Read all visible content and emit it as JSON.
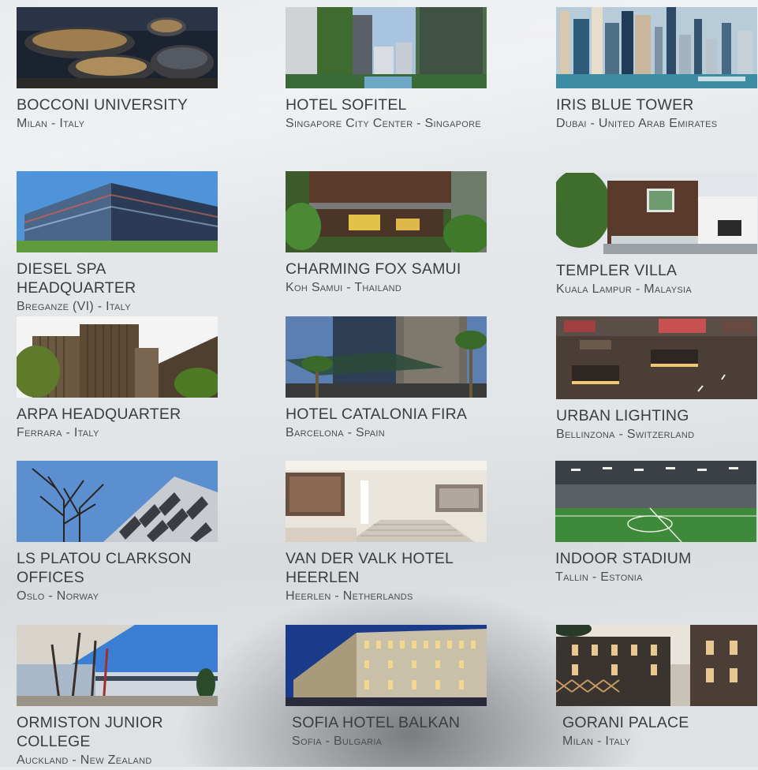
{
  "projects": [
    {
      "title": "BOCCONI UNIVERSITY",
      "location": "Milan - Italy",
      "image": "modern-campus-night-photo"
    },
    {
      "title": "HOTEL SOFITEL",
      "location": "Singapore City Center - Singapore",
      "image": "green-facade-hotel-photo"
    },
    {
      "title": "IRIS BLUE TOWER",
      "location": "Dubai - United Arab Emirates",
      "image": "marina-skyline-photo"
    },
    {
      "title": "DIESEL SPA HEADQUARTER",
      "location": "Breganze (VI) - Italy",
      "image": "glass-office-building-photo"
    },
    {
      "title": "CHARMING FOX SAMUI",
      "location": "Koh Samui - Thailand",
      "image": "tropical-resort-photo"
    },
    {
      "title": "TEMPLER VILLA",
      "location": "Kuala Lampur - Malaysia",
      "image": "modern-villa-photo"
    },
    {
      "title": "ARPA HEADQUARTER",
      "location": "Ferrara - Italy",
      "image": "wooden-slat-building-photo"
    },
    {
      "title": "HOTEL CATALONIA FIRA",
      "location": "Barcelona - Spain",
      "image": "hotel-tower-palms-photo"
    },
    {
      "title": "URBAN LIGHTING",
      "location": "Bellinzona - Switzerland",
      "image": "lit-plaza-night-photo"
    },
    {
      "title": "LS PLATOU CLARKSON OFFICES",
      "location": "Oslo - Norway",
      "image": "angular-facade-tree-photo"
    },
    {
      "title": "VAN DER VALK HOTEL HEERLEN",
      "location": "Heerlen - Netherlands",
      "image": "hotel-lobby-stairs-photo"
    },
    {
      "title": "INDOOR STADIUM",
      "location": "Tallin - Estonia",
      "image": "indoor-football-pitch-photo"
    },
    {
      "title": "ORMISTON JUNIOR COLLEGE",
      "location": "Auckland - New Zealand",
      "image": "college-courtyard-photo"
    },
    {
      "title": "SOFIA HOTEL BALKAN",
      "location": "Sofia - Bulgaria",
      "image": "historic-hotel-night-photo"
    },
    {
      "title": "GORANI PALACE",
      "location": "Milan - Italy",
      "image": "palace-render-dusk-photo"
    }
  ]
}
